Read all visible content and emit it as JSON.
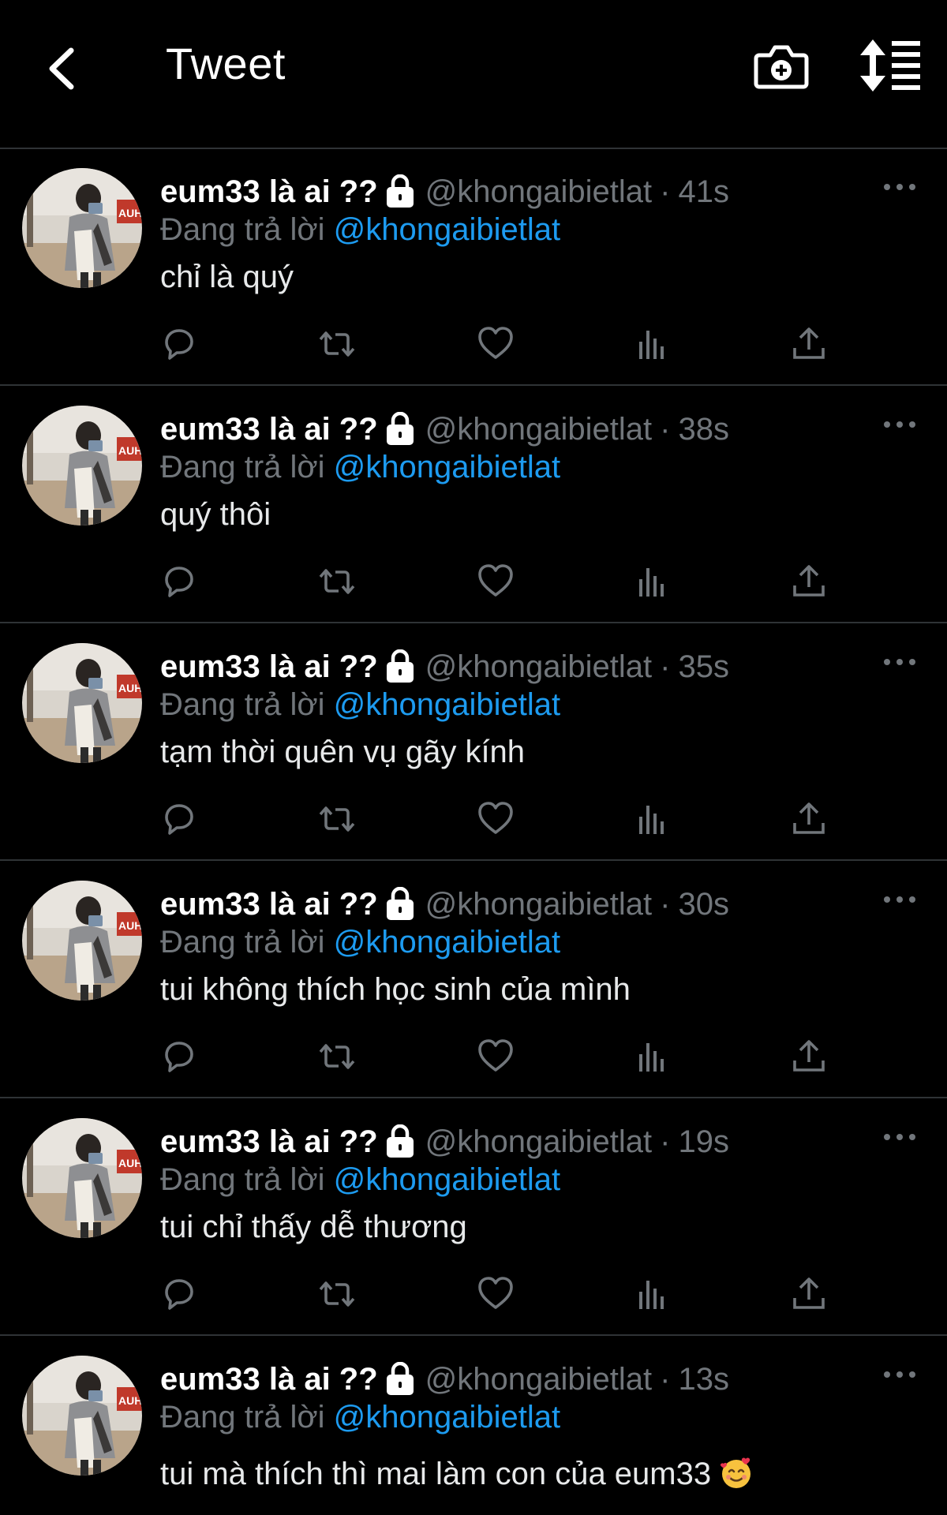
{
  "header": {
    "title": "Tweet",
    "back_icon": "chevron-left-icon",
    "camera_icon": "camera-add-icon",
    "sort_icon": "sort-icon"
  },
  "colors": {
    "background": "#000000",
    "divider": "#2f3336",
    "muted": "#71767b",
    "link": "#1d9bf0",
    "text": "#e7e9ea"
  },
  "tweets": [
    {
      "name": "eum33 là ai ??",
      "handle": "@khongaibietlat",
      "sep": "·",
      "time": "41s",
      "reply_label": "Đang trả lời",
      "reply_handle": "@khongaibietlat",
      "text": "chỉ là quý"
    },
    {
      "name": "eum33 là ai ??",
      "handle": "@khongaibietlat",
      "sep": "·",
      "time": "38s",
      "reply_label": "Đang trả lời",
      "reply_handle": "@khongaibietlat",
      "text": "quý thôi"
    },
    {
      "name": "eum33 là ai ??",
      "handle": "@khongaibietlat",
      "sep": "·",
      "time": "35s",
      "reply_label": "Đang trả lời",
      "reply_handle": "@khongaibietlat",
      "text": "tạm thời quên vụ gãy kính"
    },
    {
      "name": "eum33 là ai ??",
      "handle": "@khongaibietlat",
      "sep": "·",
      "time": "30s",
      "reply_label": "Đang trả lời",
      "reply_handle": "@khongaibietlat",
      "text": "tui không thích học sinh của mình"
    },
    {
      "name": "eum33 là ai ??",
      "handle": "@khongaibietlat",
      "sep": "·",
      "time": "19s",
      "reply_label": "Đang trả lời",
      "reply_handle": "@khongaibietlat",
      "text": "tui chỉ thấy dễ thương"
    },
    {
      "name": "eum33 là ai ??",
      "handle": "@khongaibietlat",
      "sep": "·",
      "time": "13s",
      "reply_label": "Đang trả lời",
      "reply_handle": "@khongaibietlat",
      "text": "tui mà thích thì mai làm con của eum33",
      "emoji": "smiling-face-with-hearts-icon"
    }
  ],
  "action_icons": [
    "reply-icon",
    "retweet-icon",
    "like-icon",
    "analytics-icon",
    "share-icon"
  ]
}
